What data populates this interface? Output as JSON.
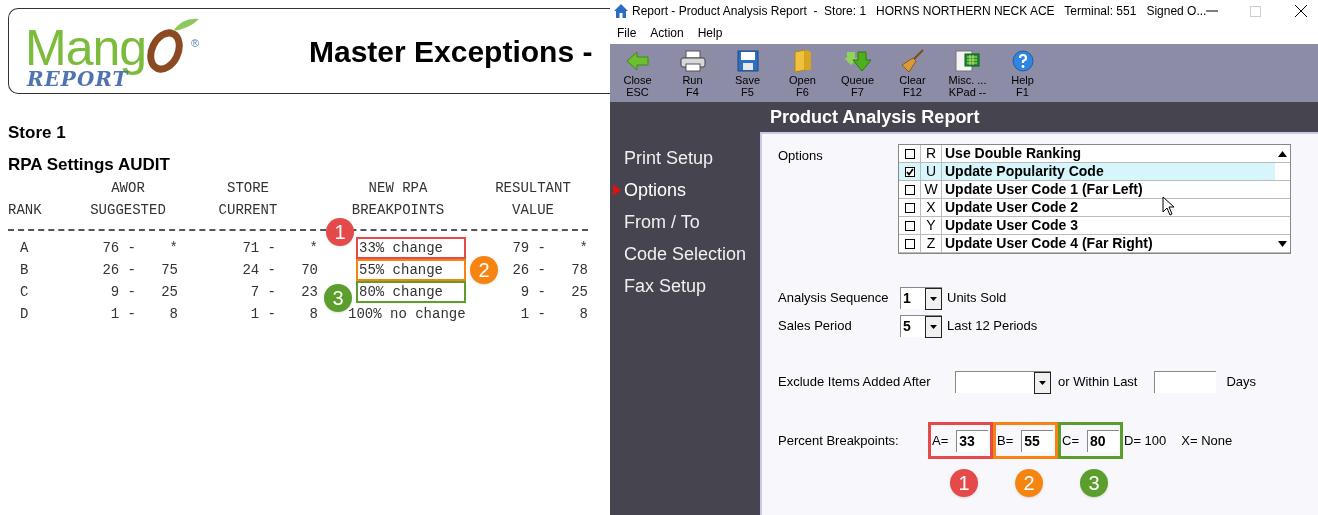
{
  "report": {
    "logo": {
      "word": "Mang",
      "sub": "REPORT",
      "mark": "®"
    },
    "title": "Master Exceptions -",
    "store": "Store 1",
    "subtitle": "RPA Settings AUDIT",
    "columns": [
      {
        "bottom": "RANK"
      },
      {
        "top": "AWOR",
        "bottom": "SUGGESTED"
      },
      {
        "top": "STORE",
        "bottom": "CURRENT"
      },
      {
        "top": "NEW RPA",
        "bottom": "BREAKPOINTS"
      },
      {
        "top": "RESULTANT",
        "bottom": "VALUE"
      }
    ],
    "rows": [
      {
        "rank": "A",
        "awor": "76 -    *",
        "store": "71 -    *",
        "breakpoint": "33% change",
        "resultant": "79 -    *",
        "marker": {
          "number": "1",
          "color": "#e44a4a"
        }
      },
      {
        "rank": "B",
        "awor": "26 -   75",
        "store": "24 -   70",
        "breakpoint": "55% change",
        "resultant": "26 -   78",
        "marker": {
          "number": "2",
          "color": "#f58410"
        }
      },
      {
        "rank": "C",
        "awor": "9 -   25",
        "store": "7 -   23",
        "breakpoint": "80% change",
        "resultant": "9 -   25",
        "marker": {
          "number": "3",
          "color": "#5c9e2c"
        }
      },
      {
        "rank": "D",
        "awor": "1 -    8",
        "store": "1 -    8",
        "breakpoint": "100% no change",
        "resultant": "1 -    8"
      }
    ]
  },
  "window": {
    "title": "Report - Product Analysis Report  -  Store: 1   HORNS NORTHERN NECK ACE   Terminal: 551   Signed O...",
    "menu": [
      "File",
      "Action",
      "Help"
    ],
    "toolbar": [
      {
        "kind": "close",
        "label": "Close",
        "key": "ESC"
      },
      {
        "kind": "run",
        "label": "Run",
        "key": "F4"
      },
      {
        "kind": "save",
        "label": "Save",
        "key": "F5"
      },
      {
        "kind": "open",
        "label": "Open",
        "key": "F6"
      },
      {
        "kind": "queue",
        "label": "Queue",
        "key": "F7"
      },
      {
        "kind": "clear",
        "label": "Clear",
        "key": "F12"
      },
      {
        "kind": "keypad",
        "label": "Misc. ...",
        "key": "KPad --"
      },
      {
        "kind": "help",
        "label": "Help",
        "key": "F1"
      }
    ],
    "nav": [
      {
        "label": "Print Setup",
        "selected": false
      },
      {
        "label": "Options",
        "selected": true
      },
      {
        "label": "From / To",
        "selected": false
      },
      {
        "label": "Code Selection",
        "selected": false
      },
      {
        "label": "Fax Setup",
        "selected": false
      }
    ],
    "heading": "Product Analysis Report",
    "options": {
      "label": "Options",
      "items": [
        {
          "letter": "R",
          "text": "Use Double Ranking",
          "checked": false,
          "selected": false
        },
        {
          "letter": "U",
          "text": "Update Popularity Code",
          "checked": true,
          "selected": true
        },
        {
          "letter": "W",
          "text": "Update User Code 1 (Far Left)",
          "checked": false,
          "selected": false
        },
        {
          "letter": "X",
          "text": "Update User Code 2",
          "checked": false,
          "selected": false
        },
        {
          "letter": "Y",
          "text": "Update User Code 3",
          "checked": false,
          "selected": false
        },
        {
          "letter": "Z",
          "text": "Update User Code 4 (Far Right)",
          "checked": false,
          "selected": false
        }
      ]
    },
    "analysis_sequence": {
      "label": "Analysis Sequence",
      "value": "1",
      "description": "Units Sold"
    },
    "sales_period": {
      "label": "Sales Period",
      "value": "5",
      "description": "Last 12 Periods"
    },
    "exclude": {
      "label": "Exclude Items Added After",
      "middle": "or Within Last",
      "unit": "Days"
    },
    "breakpoints": {
      "label": "Percent Breakpoints:",
      "fields": [
        {
          "label": "A=",
          "value": "33",
          "marker": {
            "number": "1",
            "color": "#e44a4a"
          }
        },
        {
          "label": "B=",
          "value": "55",
          "marker": {
            "number": "2",
            "color": "#f58410"
          }
        },
        {
          "label": "C=",
          "value": "80",
          "marker": {
            "number": "3",
            "color": "#5c9e2c"
          }
        }
      ],
      "notes": [
        "D= 100",
        "X= None"
      ]
    }
  }
}
